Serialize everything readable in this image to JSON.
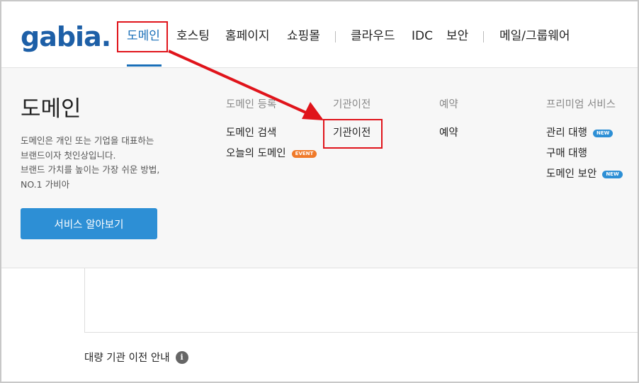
{
  "header": {
    "logo": "gabia.",
    "nav": [
      {
        "label": "도메인",
        "active": true
      },
      {
        "label": "호스팅"
      },
      {
        "label": "홈페이지"
      },
      {
        "label": "쇼핑몰"
      },
      {
        "label": "클라우드"
      },
      {
        "label": "IDC"
      },
      {
        "label": "보안"
      },
      {
        "label": "메일/그룹웨어"
      }
    ]
  },
  "panel": {
    "title": "도메인",
    "desc_lines": [
      "도메인은 개인 또는 기업을 대표하는",
      "브랜드이자 첫인상입니다.",
      "브랜드 가치를 높이는 가장 쉬운 방법,",
      "NO.1 가비아"
    ],
    "cta_label": "서비스 알아보기",
    "columns": [
      {
        "heading": "도메인 등록",
        "links": [
          {
            "label": "도메인 검색"
          },
          {
            "label": "오늘의 도메인",
            "badge": "EVENT"
          }
        ]
      },
      {
        "heading": "기관이전",
        "links": [
          {
            "label": "기관이전"
          }
        ]
      },
      {
        "heading": "예약",
        "links": [
          {
            "label": "예약"
          }
        ]
      },
      {
        "heading": "프리미엄 서비스",
        "links": [
          {
            "label": "관리 대행",
            "badge": "NEW"
          },
          {
            "label": "구매 대행"
          },
          {
            "label": "도메인 보안",
            "badge": "NEW"
          }
        ]
      }
    ]
  },
  "content": {
    "bulk_note": "대량 기관 이전 안내",
    "info_icon": "i"
  },
  "colors": {
    "brand": "#1d5fa7",
    "accent": "#2d8fd5",
    "highlight": "#e0141b",
    "event_badge": "#f07a2a"
  }
}
